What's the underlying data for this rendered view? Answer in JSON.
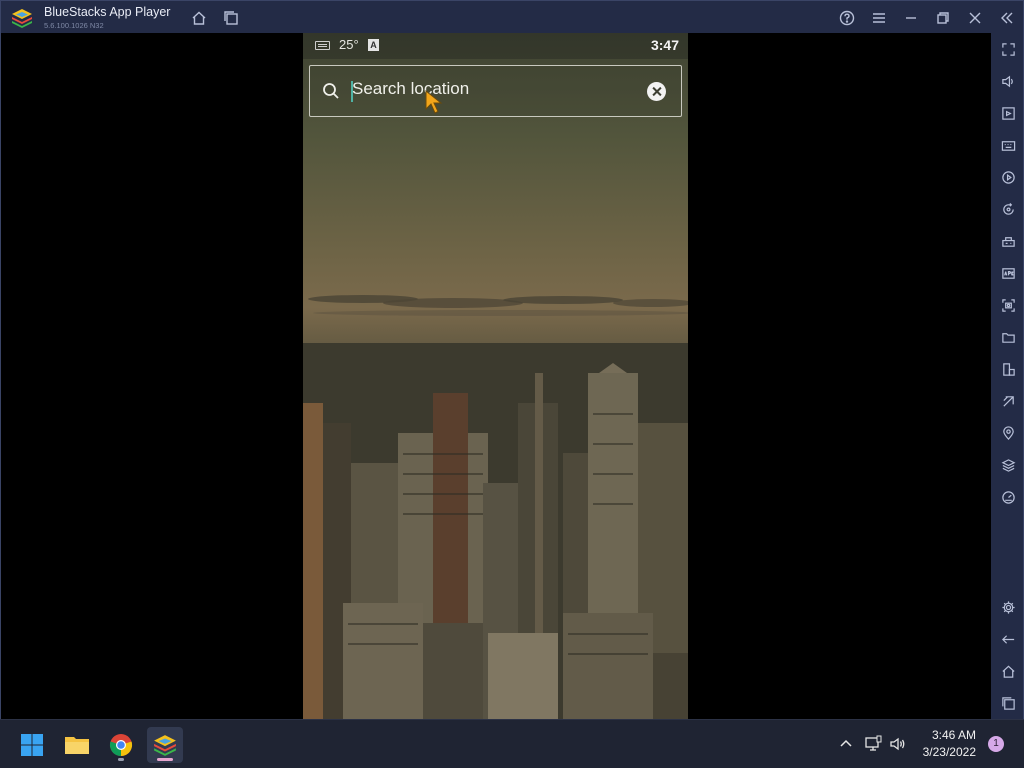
{
  "titlebar": {
    "title": "BlueStacks App Player",
    "version": "5.6.100.1026 N32",
    "buttons": [
      "home-icon",
      "multi-instance-icon",
      "help-icon",
      "menu-icon",
      "minimize-icon",
      "restore-icon",
      "close-icon",
      "collapse-sidebar-icon"
    ]
  },
  "android": {
    "status": {
      "temperature": "25°",
      "time": "3:47",
      "keyboard_icon": "keyboard-icon",
      "a_badge": "A"
    },
    "search": {
      "placeholder": "Search location"
    },
    "caret_color": "#4fb3a4"
  },
  "sidebar": {
    "tools": [
      "fullscreen-icon",
      "volume-icon",
      "screen-cast-icon",
      "keyboard-controls-icon",
      "macro-record-icon",
      "rotate-icon",
      "game-controls-icon",
      "apk-install-icon",
      "screenshot-icon",
      "folder-icon",
      "multi-device-icon",
      "eco-mode-icon",
      "location-icon",
      "layers-icon",
      "speed-icon",
      "settings-icon",
      "back-icon",
      "android-home-icon",
      "recent-apps-icon"
    ]
  },
  "taskbar": {
    "apps": [
      "windows-start-icon",
      "file-explorer-icon",
      "chrome-icon",
      "bluestacks-icon"
    ],
    "clock_time": "3:46 AM",
    "clock_date": "3/23/2022",
    "notification_count": "1"
  },
  "colors": {
    "titlebar_bg": "#232b46",
    "taskbar_bg": "#1f2433",
    "notification_badge": "#d6a9e8"
  }
}
